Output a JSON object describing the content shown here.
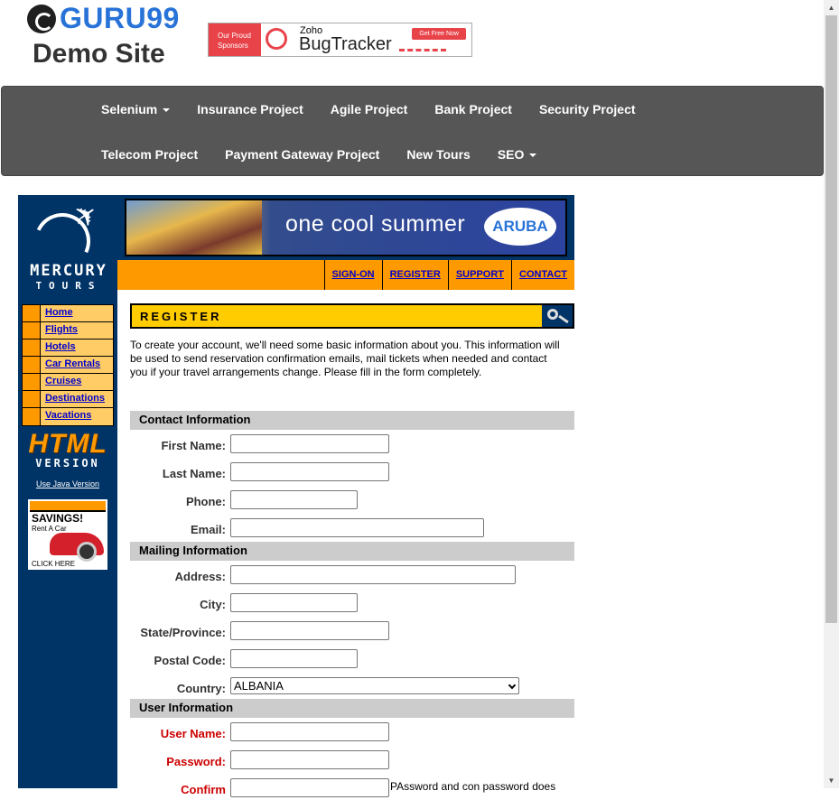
{
  "header": {
    "logo_text": "GURU99",
    "logo_subtitle": "Demo Site",
    "sponsor": {
      "label_line1": "Our Proud",
      "label_line2": "Sponsors",
      "brand_small": "Zoho",
      "brand": "BugTracker",
      "cta": "Get Free Now"
    }
  },
  "navbar": {
    "row1": [
      {
        "label": "Selenium",
        "dropdown": true
      },
      {
        "label": "Insurance Project",
        "dropdown": false
      },
      {
        "label": "Agile Project",
        "dropdown": false
      },
      {
        "label": "Bank Project",
        "dropdown": false
      },
      {
        "label": "Security Project",
        "dropdown": false
      }
    ],
    "row2": [
      {
        "label": "Telecom Project",
        "dropdown": false
      },
      {
        "label": "Payment Gateway Project",
        "dropdown": false
      },
      {
        "label": "New Tours",
        "dropdown": false
      },
      {
        "label": "SEO",
        "dropdown": true
      }
    ]
  },
  "mercury": {
    "logo_line1": "MERCURY",
    "logo_line2": "TOURS",
    "side_links": [
      "Home",
      "Flights",
      "Hotels",
      "Car Rentals",
      "Cruises",
      "Destinations",
      "Vacations"
    ],
    "html_badge": "HTML",
    "version_badge": "VERSION",
    "java_link": "Use Java Version",
    "savings": {
      "title": "SAVINGS!",
      "subtitle": "Rent A Car",
      "click": "CLICK HERE"
    },
    "banner_text": "one cool summer",
    "banner_logo": "ARUBA",
    "top_links": [
      "SIGN-ON",
      "REGISTER",
      "SUPPORT",
      "CONTACT"
    ],
    "colors": {
      "navy": "#003366",
      "orange": "#ff9900",
      "yellow": "#ffcc00"
    }
  },
  "register": {
    "title": "REGISTER",
    "intro": "To create your account, we'll need some basic information about you. This information will be used to send reservation confirmation emails, mail tickets when needed and contact you if your travel arrangements change. Please fill in the form completely.",
    "sections": {
      "contact": "Contact Information",
      "mailing": "Mailing Information",
      "user": "User Information"
    },
    "labels": {
      "first_name": "First Name:",
      "last_name": "Last Name:",
      "phone": "Phone:",
      "email": "Email:",
      "address": "Address:",
      "city": "City:",
      "state": "State/Province:",
      "postal": "Postal Code:",
      "country": "Country:",
      "user_name": "User Name:",
      "password": "Password:",
      "confirm": "Confirm"
    },
    "values": {
      "first_name": "",
      "last_name": "",
      "phone": "",
      "email": "",
      "address": "",
      "city": "",
      "state": "",
      "postal": "",
      "country": "ALBANIA",
      "user_name": "",
      "password": "",
      "confirm": ""
    },
    "confirm_note": "PAssword and con password does"
  }
}
